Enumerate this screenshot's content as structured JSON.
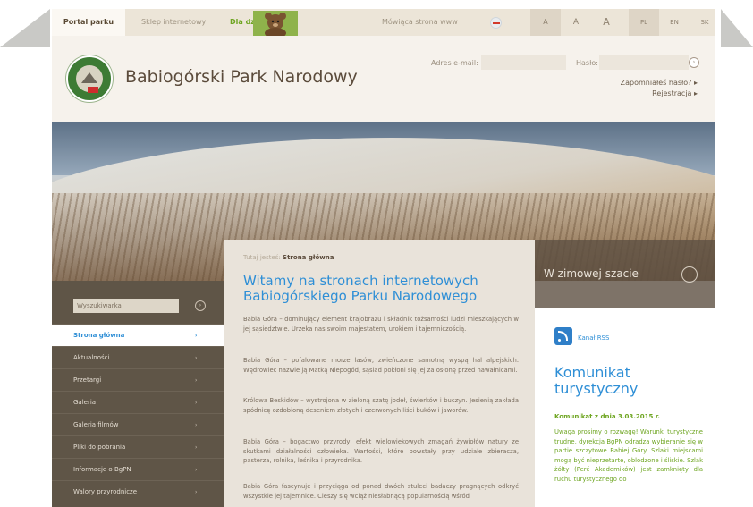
{
  "topbar": {
    "tab_portal": "Portal parku",
    "tab_shop": "Sklep internetowy",
    "tab_kids": "Dla dzieci",
    "voice_label": "Mówiąca strona www",
    "voice_icon": "speaker-icon",
    "font_small": "A",
    "font_medium": "A",
    "font_large": "A",
    "lang_pl": "PL",
    "lang_en": "EN",
    "lang_sk": "SK"
  },
  "header": {
    "site_title": "Babiogórski Park Narodowy",
    "email_label": "Adres e-mail:",
    "password_label": "Hasło:",
    "forgot_link": "Zapomniałeś hasło? ▸",
    "register_link": "Rejestracja ▸",
    "go_symbol": "›"
  },
  "banner": {
    "caption": "W zimowej szacie"
  },
  "sidebar": {
    "search_placeholder": "Wyszukiwarka",
    "items": [
      {
        "label": "Strona główna",
        "arrow": "›"
      },
      {
        "label": "Aktualności",
        "arrow": "›"
      },
      {
        "label": "Przetargi",
        "arrow": "›"
      },
      {
        "label": "Galeria",
        "arrow": "›"
      },
      {
        "label": "Galeria filmów",
        "arrow": "›"
      },
      {
        "label": "Pliki do pobrania",
        "arrow": "›"
      },
      {
        "label": "Informacje o BgPN",
        "arrow": "›"
      },
      {
        "label": "Walory przyrodnicze",
        "arrow": "›"
      }
    ]
  },
  "main": {
    "crumb_prefix": "Tutaj jesteś:",
    "crumb_current": "Strona główna",
    "heading": "Witamy na stronach internetowych Babiogórskiego Parku Narodowego",
    "paragraphs": [
      "Babia Góra – dominujący element krajobrazu i składnik tożsamości ludzi mieszkających w jej sąsiedztwie. Urzeka nas swoim majestatem, urokiem i tajemniczością.",
      "Babia Góra – pofalowane morze lasów, zwieńczone samotną wyspą hal alpejskich. Wędrowiec nazwie ją Matką Niepogód, sąsiad pokłoni się jej za osłonę przed nawałnicami.",
      "Królowa Beskidów – wystrojona w zieloną szatę jodeł, świerków i buczyn. Jesienią zakłada spódnicę ozdobioną deseniem złotych i czerwonych liści buków i jaworów.",
      "Babia Góra – bogactwo przyrody, efekt wielowiekowych zmagań żywiołów natury ze skutkami działalności człowieka. Wartości, które powstały przy udziale zbieracza, pasterza, rolnika, leśnika i przyrodnika.",
      "Babia Góra fascynuje i przyciąga od ponad dwóch stuleci badaczy pragnących odkryć wszystkie jej tajemnice. Cieszy się wciąż niesłabnącą popularnością wśród"
    ]
  },
  "right": {
    "rss_label": "Kanał RSS",
    "komunikat_title": "Komunikat turystyczny",
    "komunikat_date": "Komunikat z dnia 3.03.2015 r.",
    "komunikat_text": "Uwaga prosimy o rozwagę! Warunki turystyczne trudne, dyrekcja BgPN odradza wybieranie się w partie szczytowe Babiej Góry. Szlaki miejscami mogą być nieprzetarte, oblodzone i śliskie. Szlak żółty (Perć Akademików) jest zamknięty dla ruchu turystycznego do"
  },
  "colors": {
    "accent_blue": "#2f8fd6",
    "accent_green": "#6ea521",
    "sidebar_bg": "#5f5547"
  }
}
